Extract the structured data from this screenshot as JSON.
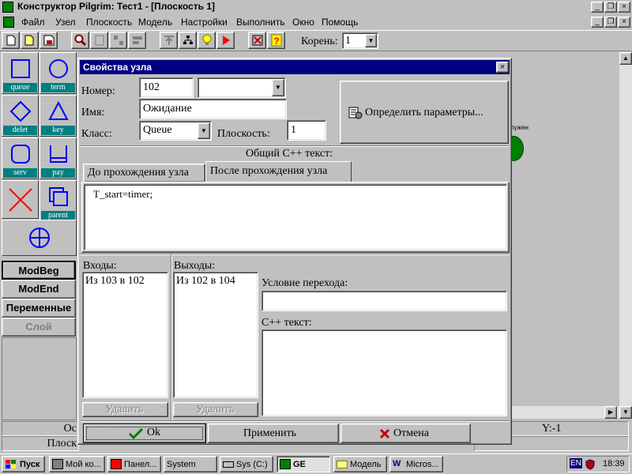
{
  "titlebar": {
    "title": "Конструктор Pilgrim: Тест1 - [Плоскость 1]"
  },
  "menu": [
    "Файл",
    "Узел",
    "Плоскость",
    "Модель",
    "Настройки",
    "Выполнить",
    "Окно",
    "Помощь"
  ],
  "toolbar": {
    "root_label": "Корень:",
    "root_value": "1"
  },
  "palette": [
    {
      "label": "queue",
      "shape": "square-icon"
    },
    {
      "label": "term",
      "shape": "circle-icon"
    },
    {
      "label": "delet",
      "shape": "diamond-icon"
    },
    {
      "label": "key",
      "shape": "triangle-icon"
    },
    {
      "label": "serv",
      "shape": "rounded-square-icon"
    },
    {
      "label": "pay",
      "shape": "open-box-icon"
    },
    {
      "label": "",
      "shape": "cross-icon"
    },
    {
      "label": "parent",
      "shape": "stacked-squares-icon"
    }
  ],
  "side_buttons": [
    "ModBeg",
    "ModEnd",
    "Переменные",
    "Слой"
  ],
  "canvas": {
    "fragment": "лужен"
  },
  "dialog": {
    "title": "Свойства узла",
    "number_label": "Номер:",
    "number_value": "102",
    "name_label": "Имя:",
    "name_value": "Ожидание",
    "class_label": "Класс:",
    "class_value": "Queue",
    "plane_label": "Плоскость:",
    "plane_value": "1",
    "define_params": "Определить параметры...",
    "cpp_header": "Общий C++ текст:",
    "tabs": [
      "До прохождения узла",
      "После прохождения узла"
    ],
    "code": "T_start=timer;",
    "inputs_label": "Входы:",
    "inputs": [
      "Из 103 в 102"
    ],
    "outputs_label": "Выходы:",
    "outputs": [
      "Из 102 в 104"
    ],
    "condition_label": "Условие перехода:",
    "cpp_text_label": "C++ текст:",
    "delete_label": "Удалить",
    "ok": "Ok",
    "apply": "Применить",
    "cancel": "Отмена"
  },
  "statusbar": {
    "left1": "Ос",
    "left2": "Плоск",
    "coord": "Y:-1"
  },
  "taskbar": {
    "start": "Пуск",
    "items": [
      "Мой ко...",
      "Панел...",
      "System",
      "Sys (C:)",
      "GE",
      "Модель",
      "Micros..."
    ],
    "lang": "EN",
    "clock": "18:39"
  },
  "colors": {
    "titlebar": "#000080",
    "teal": "#008080",
    "shape_blue": "#0000ff",
    "cross_red": "#ff0000",
    "check_green": "#008000"
  }
}
